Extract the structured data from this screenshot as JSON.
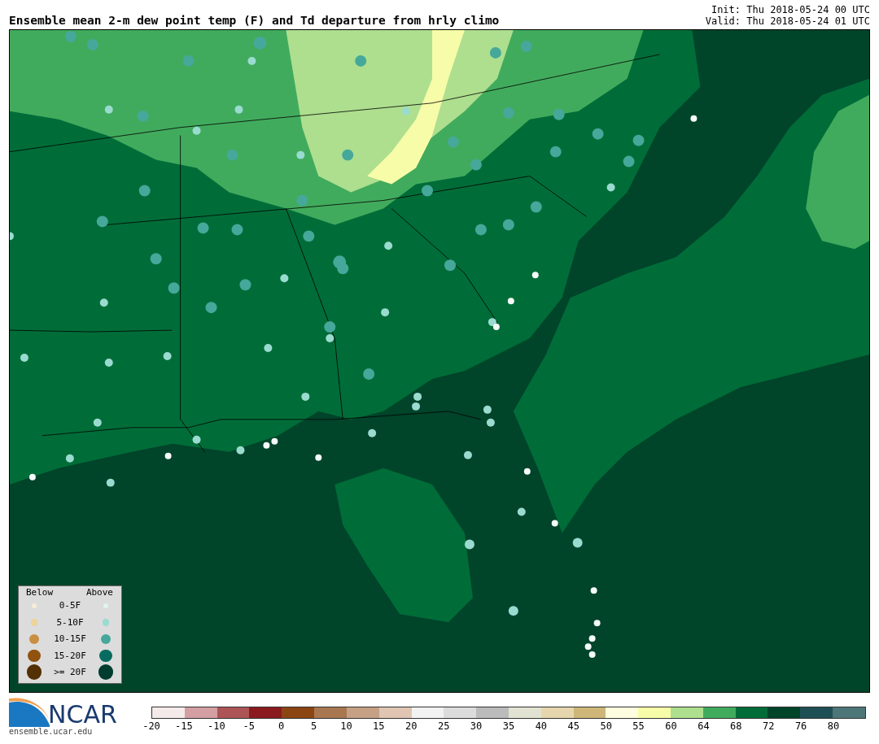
{
  "header": {
    "title": "Ensemble mean 2-m dew point temp (F) and Td departure from hrly climo",
    "init": "Init: Thu 2018-05-24 00 UTC",
    "valid": "Valid: Thu 2018-05-24 01 UTC"
  },
  "legend": {
    "below_heading": "Below",
    "above_heading": "Above",
    "entries": [
      {
        "label": "0-5F",
        "markers": [
          {
            "color": "#f5ecd8"
          },
          {
            "color": "#e0f3f0"
          }
        ]
      },
      {
        "label": "5-10F",
        "markers": [
          {
            "color": "#ecd49a"
          },
          {
            "color": "#9adbd0"
          }
        ]
      },
      {
        "label": "10-15F",
        "markers": [
          {
            "color": "#c98f40"
          },
          {
            "color": "#45a89a"
          }
        ]
      },
      {
        "label": "15-20F",
        "markers": [
          {
            "color": "#8f520f"
          },
          {
            "color": "#086b5f"
          }
        ]
      },
      {
        "label": ">= 20F",
        "markers": [
          {
            "color": "#543005"
          },
          {
            "color": "#003c30"
          }
        ]
      }
    ]
  },
  "logo": {
    "name": "NCAR",
    "url": "ensemble.ucar.edu"
  },
  "colorbar": [
    {
      "label": "-20",
      "color": "#f5eaea"
    },
    {
      "label": "-15",
      "color": "#d39fa2"
    },
    {
      "label": "-10",
      "color": "#ad5457"
    },
    {
      "label": "-5",
      "color": "#8b1a1f"
    },
    {
      "label": "0",
      "color": "#8b4513"
    },
    {
      "label": "5",
      "color": "#a87750"
    },
    {
      "label": "10",
      "color": "#c5a084"
    },
    {
      "label": "15",
      "color": "#dfc5b2"
    },
    {
      "label": "20",
      "color": "#f2f2f2"
    },
    {
      "label": "25",
      "color": "#dcdcdc"
    },
    {
      "label": "30",
      "color": "#bbbbbb"
    },
    {
      "label": "35",
      "color": "#e2e2d2"
    },
    {
      "label": "40",
      "color": "#e6d6ae"
    },
    {
      "label": "45",
      "color": "#cdb678"
    },
    {
      "label": "50",
      "color": "#fffde0"
    },
    {
      "label": "55",
      "color": "#f7fca8"
    },
    {
      "label": "60",
      "color": "#addf8e"
    },
    {
      "label": "64",
      "color": "#41ab5d"
    },
    {
      "label": "68",
      "color": "#006d38"
    },
    {
      "label": "72",
      "color": "#00442a"
    },
    {
      "label": "76",
      "color": "#1d4f54"
    },
    {
      "label": "80",
      "color": "#4d7679"
    }
  ]
}
